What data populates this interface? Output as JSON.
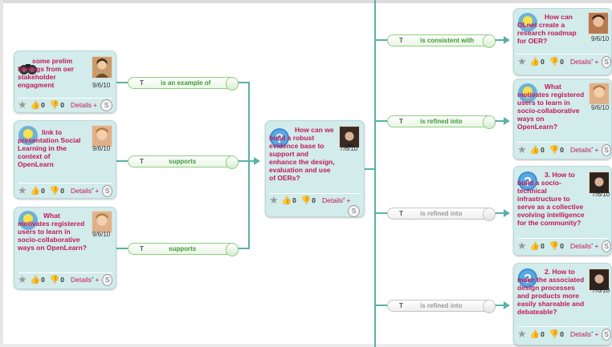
{
  "relations": {
    "example_of": "is an example of",
    "supports_1": "supports",
    "supports_2": "supports",
    "consistent_with": "is consistent with",
    "refined_1": "is refined into",
    "refined_2": "is refined into",
    "refined_3": "is refined into",
    "type_letter": "T"
  },
  "nodes": {
    "prelim": {
      "title": "some prelim findings from oer stakeholder engagment",
      "date": "9/6/10",
      "likes": "0",
      "dislikes": "0",
      "details": "Details",
      "plus": "+",
      "s": "S",
      "icon": "binoculars-icon"
    },
    "link": {
      "title": "link to presentation Social Learning in the context of OpenLearn",
      "date": "9/6/10",
      "likes": "0",
      "dislikes": "0",
      "details": "Details",
      "sup": "*",
      "plus": "+",
      "s": "S",
      "icon": "lightbulb-icon"
    },
    "motivates_left": {
      "title": "What motivates registered users to learn in socio-collaborative ways on OpenLearn?",
      "date": "9/6/10",
      "likes": "0",
      "dislikes": "0",
      "details": "Details",
      "sup": "*",
      "plus": "+",
      "s": "S",
      "icon": "lightbulb-icon"
    },
    "center": {
      "title": "How can we build a robust evidence base to support and enhance the design, evaluation and use of OERs?",
      "date": "7/6/10",
      "likes": "0",
      "dislikes": "0",
      "details": "Details",
      "sup": "*",
      "plus": "+",
      "s": "S",
      "icon": "question-icon"
    },
    "roadmap": {
      "title": "How can OLnet create a research roadmap for OER?",
      "date": "9/6/10",
      "likes": "0",
      "dislikes": "0",
      "details": "Details",
      "sup": "*",
      "plus": "+",
      "s": "S",
      "icon": "lightbulb-icon"
    },
    "motivates_right": {
      "title": "What motivates registered users to learn in socio-collaborative ways on OpenLearn?",
      "date": "9/6/10",
      "likes": "0",
      "dislikes": "0",
      "details": "Details",
      "sup": "*",
      "plus": "+",
      "s": "S",
      "icon": "lightbulb-icon"
    },
    "infra": {
      "title": "3. How to build a socio-technical infrastructure to serve as a collective evolving intelligence for the community?",
      "date": "7/6/10",
      "likes": "0",
      "dislikes": "0",
      "details": "Details",
      "sup": "*",
      "plus": "+",
      "s": "S",
      "icon": "question-icon"
    },
    "design": {
      "title": "2. How to make the associated design processes and products more easily shareable and debateable?",
      "date": "7/6/10",
      "likes": "0",
      "dislikes": "0",
      "details": "Details",
      "sup": "*",
      "plus": "+",
      "s": "S",
      "icon": "question-icon"
    }
  },
  "colors": {
    "node_bg": "#d2ebeb",
    "title": "#c2185b",
    "connector": "#5bb0a8",
    "pill_green": "#3a9a37",
    "pill_grey": "#999999"
  }
}
